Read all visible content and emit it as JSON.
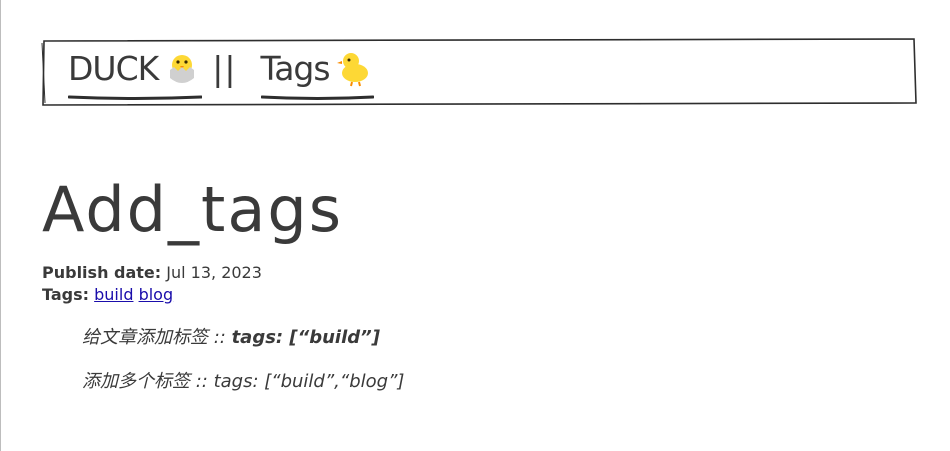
{
  "nav": {
    "home_label": "DUCK",
    "home_icon": "hatching-chick-icon",
    "separator": "||",
    "tags_label": "Tags",
    "tags_icon": "baby-chick-icon"
  },
  "post": {
    "title": "Add_tags",
    "publish_label": "Publish date:",
    "publish_date": "Jul 13, 2023",
    "tags_label": "Tags:",
    "tags": [
      "build",
      "blog"
    ]
  },
  "content": {
    "line1_prefix": "给文章添加标签 :: ",
    "line1_code": "tags: [“build”]",
    "line2": "添加多个标签 :: tags: [“build”,“blog”]"
  },
  "colors": {
    "text": "#3a3a3a",
    "link": "#1a0dab",
    "chick_yellow": "#fdd835"
  }
}
